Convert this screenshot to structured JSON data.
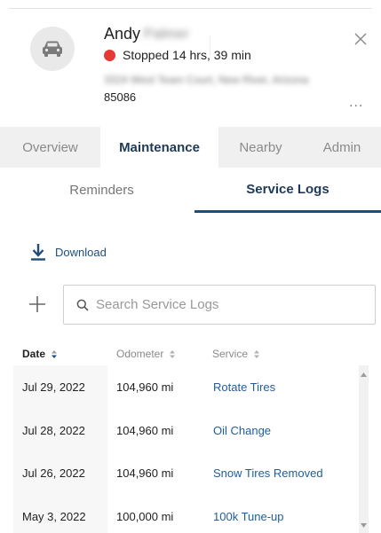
{
  "vehicle": {
    "first_name": "Andy",
    "last_name": "Palmer",
    "status": "Stopped 14 hrs, 39 min",
    "status_color": "#e53935",
    "address_line": "3324 West Team Court, New River, Arizona",
    "zip": "85086",
    "more_label": "..."
  },
  "main_tabs": [
    {
      "label": "Overview",
      "active": false
    },
    {
      "label": "Maintenance",
      "active": true
    },
    {
      "label": "Nearby",
      "active": false
    },
    {
      "label": "Admin",
      "active": false
    }
  ],
  "sub_tabs": [
    {
      "label": "Reminders",
      "active": false
    },
    {
      "label": "Service Logs",
      "active": true
    }
  ],
  "download": {
    "label": "Download"
  },
  "search": {
    "placeholder": "Search Service Logs",
    "value": ""
  },
  "table": {
    "columns": [
      "Date",
      "Odometer",
      "Service"
    ],
    "rows": [
      {
        "date": "Jul 29, 2022",
        "odometer": "104,960 mi",
        "service": "Rotate Tires"
      },
      {
        "date": "Jul 28, 2022",
        "odometer": "104,960 mi",
        "service": "Oil Change"
      },
      {
        "date": "Jul 26, 2022",
        "odometer": "104,960 mi",
        "service": "Snow Tires Removed"
      },
      {
        "date": "May 3, 2022",
        "odometer": "100,000 mi",
        "service": "100k Tune-up"
      }
    ]
  },
  "colors": {
    "accent": "#1f4e79",
    "link": "#1f5d9c",
    "tab_bar": "#f0f0f0"
  }
}
